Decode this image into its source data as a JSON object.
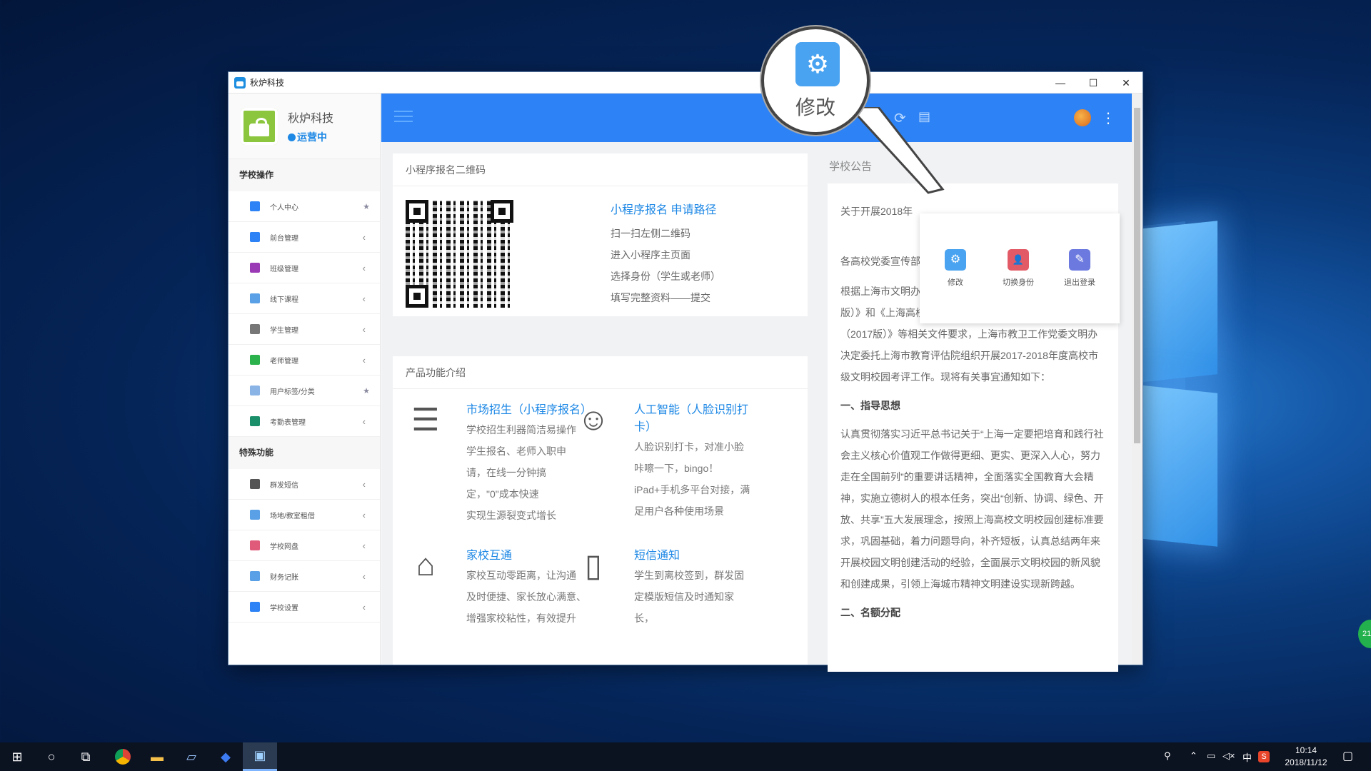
{
  "app": {
    "title": "秋炉科技"
  },
  "brand": {
    "name": "秋炉科技",
    "status": "运营中"
  },
  "sidebar": {
    "sections": [
      {
        "title": "学校操作",
        "items": [
          {
            "label": "个人中心",
            "mark": "★",
            "color": "#2d83f5"
          },
          {
            "label": "前台管理",
            "mark": "‹",
            "color": "#2d83f5"
          },
          {
            "label": "班级管理",
            "mark": "‹",
            "color": "#9b3ab5"
          },
          {
            "label": "线下课程",
            "mark": "‹",
            "color": "#5aa0e6"
          },
          {
            "label": "学生管理",
            "mark": "‹",
            "color": "#777777"
          },
          {
            "label": "老师管理",
            "mark": "‹",
            "color": "#2bb24c"
          },
          {
            "label": "用户标签/分类",
            "mark": "★",
            "color": "#8ab4e6"
          },
          {
            "label": "考勤表管理",
            "mark": "‹",
            "color": "#1a8f6a"
          }
        ]
      },
      {
        "title": "特殊功能",
        "items": [
          {
            "label": "群发短信",
            "mark": "‹",
            "color": "#555555"
          },
          {
            "label": "场地/教室租借",
            "mark": "‹",
            "color": "#5aa0e6"
          },
          {
            "label": "学校网盘",
            "mark": "‹",
            "color": "#e05a7a"
          },
          {
            "label": "财务记账",
            "mark": "‹",
            "color": "#5aa0e6"
          },
          {
            "label": "学校设置",
            "mark": "‹",
            "color": "#2d83f5"
          }
        ]
      }
    ]
  },
  "qr_card": {
    "title": "小程序报名二维码",
    "steps_title": "小程序报名 申请路径",
    "steps": [
      "扫一扫左侧二维码",
      "进入小程序主页面",
      "选择身份（学生或老师）",
      "填写完整资料——提交"
    ]
  },
  "features": {
    "title": "产品功能介绍",
    "items": [
      {
        "icon": "list-indent-icon",
        "glyph": "☰",
        "title": "市场招生（小程序报名）",
        "lines": [
          "学校招生利器简洁易操作",
          "学生报名、老师入职申",
          "请，在线一分钟搞",
          "定，\"0\"成本快速",
          "实现生源裂变式增长"
        ]
      },
      {
        "icon": "face-icon",
        "glyph": "☺",
        "title": "人工智能（人脸识别打卡）",
        "lines": [
          "人脸识别打卡，对准小脸",
          "咔嚓一下，bingo！",
          "iPad+手机多平台对接，满",
          "足用户各种使用场景"
        ]
      },
      {
        "icon": "home-icon",
        "glyph": "⌂",
        "title": "家校互通",
        "lines": [
          "家校互动零距离，让沟通",
          "及时便捷、家长放心满意、",
          "增强家校粘性，有效提升"
        ]
      },
      {
        "icon": "phone-icon",
        "glyph": "▯",
        "title": "短信通知",
        "lines": [
          "学生到离校签到，群发固",
          "定模版短信及时通知家",
          "长，"
        ]
      }
    ]
  },
  "notice": {
    "title": "学校公告",
    "headline": "关于开展2018年",
    "paragraphs": [
      "各高校党委宣传部、民办高校党工委办公室：",
      "根据上海市文明办《上海市文明单位创建管理规定（2017版）》和《上海高校文明单位（文明校园）创建评价指标体系（2017版）》等相关文件要求，上海市教卫工作党委文明办决定委托上海市教育评估院组织开展2017-2018年度高校市级文明校园考评工作。现将有关事宜通知如下：",
      "一、指导思想",
      "认真贯彻落实习近平总书记关于“上海一定要把培育和践行社会主义核心价值观工作做得更细、更实、更深入人心，努力走在全国前列”的重要讲话精神，全面落实全国教育大会精神，实施立德树人的根本任务，突出“创新、协调、绿色、开放、共享”五大发展理念，按照上海高校文明校园创建标准要求，巩固基础，着力问题导向，补齐短板，认真总结两年来开展校园文明创建活动的经验，全面展示文明校园的新风貌和创建成果，引领上海城市精神文明建设实现新跨越。",
      "二、名额分配"
    ]
  },
  "dropdown": {
    "items": [
      {
        "label": "修改",
        "icon": "gear-icon",
        "glyph": "⚙",
        "color": "#4aa3f0"
      },
      {
        "label": "切换身份",
        "icon": "user-icon",
        "glyph": "👤",
        "color": "#e25a66"
      },
      {
        "label": "退出登录",
        "icon": "logout-icon",
        "glyph": "✎",
        "color": "#6c7ae0"
      }
    ]
  },
  "magnifier": {
    "label": "修改",
    "glyph": "⚙"
  },
  "header_icons": {
    "back": "↩",
    "refresh": "⟳",
    "message": "▤",
    "more": "⋮"
  },
  "taskbar": {
    "time": "10:14",
    "date": "2018/11/12",
    "ime": "中",
    "badge": "21"
  }
}
